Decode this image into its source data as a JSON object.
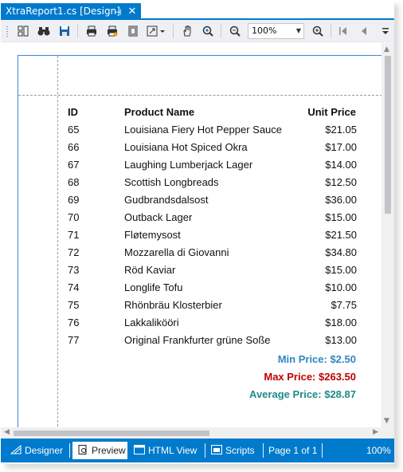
{
  "tab": {
    "title": "XtraReport1.cs [Design]",
    "pin_icon": "pin-icon",
    "close_icon": "close-icon"
  },
  "toolbar": {
    "icons": [
      "grip",
      "thumbnails-icon",
      "search-binoculars-icon",
      "save-icon",
      "print-icon",
      "quick-print-icon",
      "page-setup-icon",
      "scale-icon",
      "hand-tool-icon",
      "magnifier-icon",
      "zoom-out-icon",
      "zoom-in-icon",
      "first-page-icon",
      "previous-page-icon",
      "overflow-icon"
    ],
    "zoom_value": "100%"
  },
  "report": {
    "headers": {
      "id": "ID",
      "name": "Product Name",
      "price": "Unit Price"
    },
    "rows": [
      {
        "id": "65",
        "name": "Louisiana Fiery Hot Pepper Sauce",
        "price": "$21.05"
      },
      {
        "id": "66",
        "name": "Louisiana Hot Spiced Okra",
        "price": "$17.00"
      },
      {
        "id": "67",
        "name": "Laughing Lumberjack Lager",
        "price": "$14.00"
      },
      {
        "id": "68",
        "name": "Scottish Longbreads",
        "price": "$12.50"
      },
      {
        "id": "69",
        "name": "Gudbrandsdalsost",
        "price": "$36.00"
      },
      {
        "id": "70",
        "name": "Outback Lager",
        "price": "$15.00"
      },
      {
        "id": "71",
        "name": "Fløtemysost",
        "price": "$21.50"
      },
      {
        "id": "72",
        "name": "Mozzarella di Giovanni",
        "price": "$34.80"
      },
      {
        "id": "73",
        "name": "Röd Kaviar",
        "price": "$15.00"
      },
      {
        "id": "74",
        "name": "Longlife Tofu",
        "price": "$10.00"
      },
      {
        "id": "75",
        "name": "Rhönbräu Klosterbier",
        "price": "$7.75"
      },
      {
        "id": "76",
        "name": "Lakkalikööri",
        "price": "$18.00"
      },
      {
        "id": "77",
        "name": "Original Frankfurter grüne Soße",
        "price": "$13.00"
      }
    ],
    "summary": {
      "min": "Min Price: $2.50",
      "max": "Max Price: $263.50",
      "avg": "Average Price: $28.87"
    }
  },
  "statusbar": {
    "designer": "Designer",
    "preview": "Preview",
    "html_view": "HTML View",
    "scripts": "Scripts",
    "page_info": "Page 1 of 1",
    "zoom": "100%"
  },
  "colors": {
    "accent": "#007acc",
    "min_price": "#2e86c1",
    "max_price": "#c00000",
    "avg_price": "#1f8a8a"
  }
}
